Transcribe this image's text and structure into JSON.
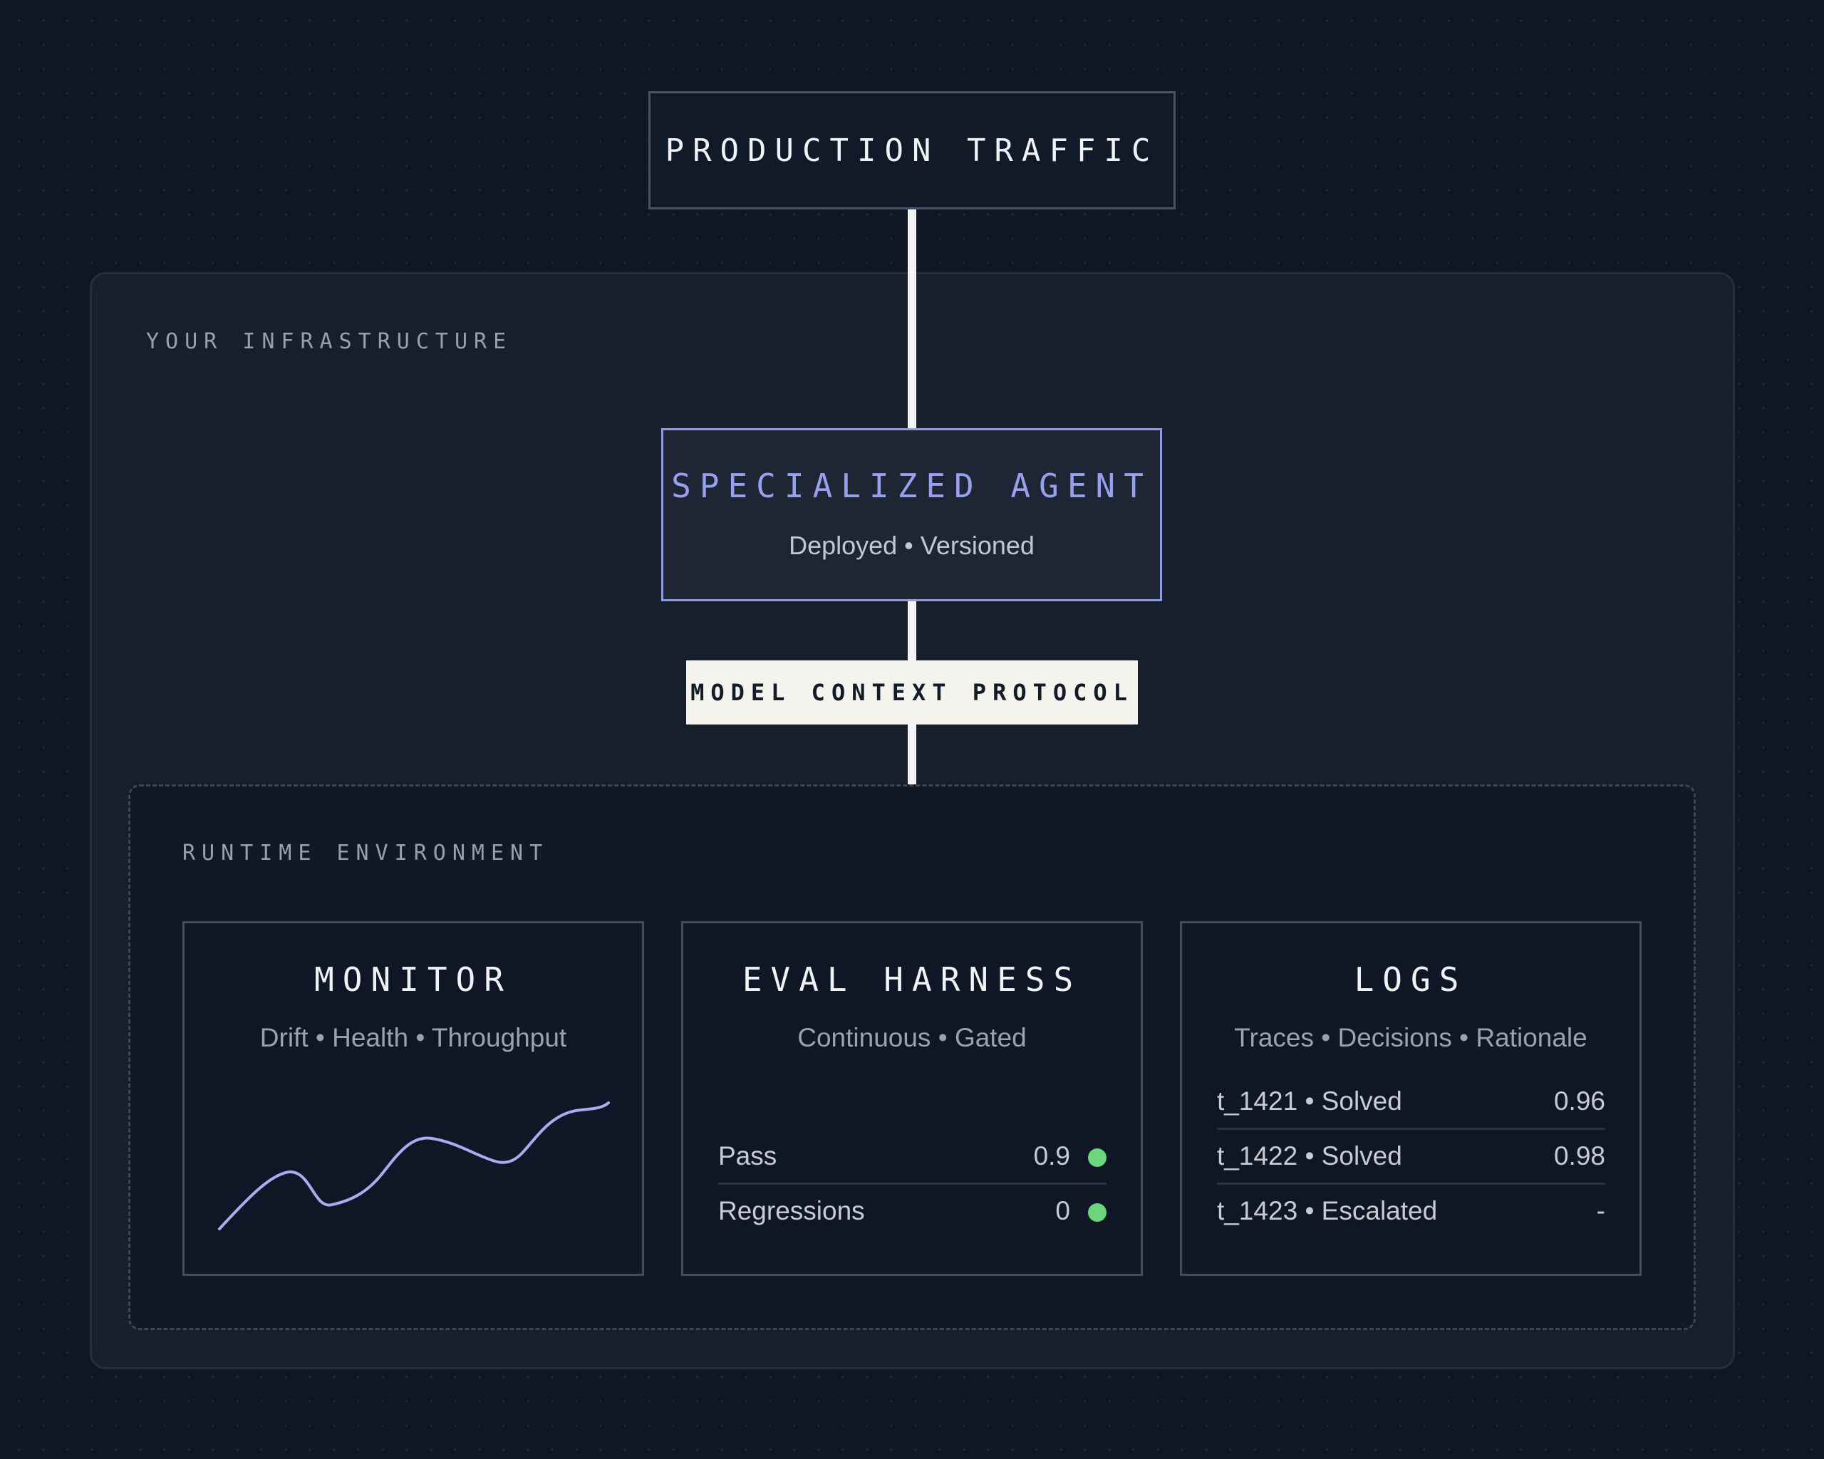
{
  "top": {
    "title": "PRODUCTION TRAFFIC"
  },
  "infrastructure": {
    "label": "YOUR INFRASTRUCTURE"
  },
  "agent": {
    "title": "SPECIALIZED AGENT",
    "subtitle": "Deployed • Versioned"
  },
  "protocol": {
    "label": "MODEL CONTEXT PROTOCOL"
  },
  "runtime": {
    "label": "RUNTIME ENVIRONMENT"
  },
  "monitor": {
    "title": "MONITOR",
    "subtitle": "Drift • Health • Throughput",
    "line_color": "#a7aef0"
  },
  "eval": {
    "title": "EVAL HARNESS",
    "subtitle": "Continuous • Gated",
    "rows": [
      {
        "label": "Pass",
        "value": "0.9",
        "status": "green"
      },
      {
        "label": "Regressions",
        "value": "0",
        "status": "green"
      }
    ]
  },
  "logs": {
    "title": "LOGS",
    "subtitle": "Traces • Decisions • Rationale",
    "rows": [
      {
        "label": "t_1421 • Solved",
        "value": "0.96"
      },
      {
        "label": "t_1422 • Solved",
        "value": "0.98"
      },
      {
        "label": "t_1423 • Escalated",
        "value": "-"
      }
    ]
  },
  "colors": {
    "background": "#0f1726",
    "accent": "#96a0ec",
    "status_green": "#6bd67b",
    "connector": "#f4f4f2"
  }
}
